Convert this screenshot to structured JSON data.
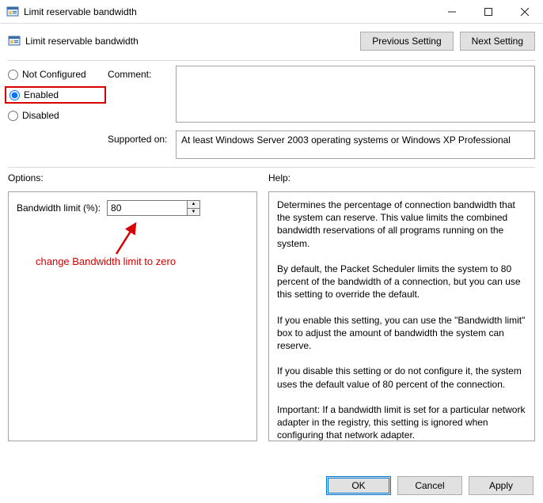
{
  "window": {
    "title": "Limit reservable bandwidth",
    "subtitle": "Limit reservable bandwidth"
  },
  "nav": {
    "previous": "Previous Setting",
    "next": "Next Setting"
  },
  "state": {
    "not_configured": "Not Configured",
    "enabled": "Enabled",
    "disabled": "Disabled",
    "selected": "enabled"
  },
  "labels": {
    "comment": "Comment:",
    "supported_on": "Supported on:",
    "options": "Options:",
    "help": "Help:"
  },
  "supported_on_text": "At least Windows Server 2003 operating systems or Windows XP Professional",
  "options": {
    "bandwidth_label": "Bandwidth limit (%):",
    "bandwidth_value": "80"
  },
  "annotation": "change Bandwidth limit to zero",
  "help_text": "Determines the percentage of connection bandwidth that the system can reserve. This value limits the combined bandwidth reservations of all programs running on the system.\n\nBy default, the Packet Scheduler limits the system to 80 percent of the bandwidth of a connection, but you can use this setting to override the default.\n\nIf you enable this setting, you can use the \"Bandwidth limit\" box to adjust the amount of bandwidth the system can reserve.\n\nIf you disable this setting or do not configure it, the system uses the default value of 80 percent of the connection.\n\nImportant: If a bandwidth limit is set for a particular network adapter in the registry, this setting is ignored when configuring that network adapter.",
  "buttons": {
    "ok": "OK",
    "cancel": "Cancel",
    "apply": "Apply"
  }
}
